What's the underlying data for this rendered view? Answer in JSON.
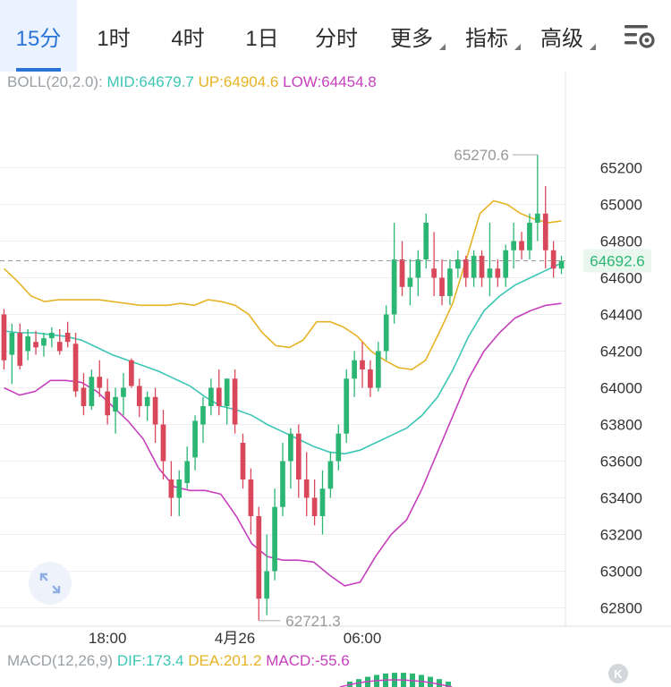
{
  "tabs": [
    {
      "label": "15分",
      "active": true,
      "dropdown": false
    },
    {
      "label": "1时",
      "active": false,
      "dropdown": false
    },
    {
      "label": "4时",
      "active": false,
      "dropdown": false
    },
    {
      "label": "1日",
      "active": false,
      "dropdown": false
    },
    {
      "label": "分时",
      "active": false,
      "dropdown": false
    },
    {
      "label": "更多",
      "active": false,
      "dropdown": true
    },
    {
      "label": "指标",
      "active": false,
      "dropdown": true
    },
    {
      "label": "高级",
      "active": false,
      "dropdown": true
    }
  ],
  "settings_icon": "chart-settings-icon",
  "boll": {
    "name": "BOLL(20,2.0):",
    "mid_label": "MID:64679.7",
    "up_label": "UP:64904.6",
    "low_label": "LOW:64454.8",
    "colors": {
      "mid": "#3cc6b5",
      "up": "#e6b325",
      "low": "#c63fbc"
    }
  },
  "macd": {
    "name": "MACD(12,26,9)",
    "dif_label": "DIF:173.4",
    "dea_label": "DEA:201.2",
    "macd_label": "MACD:-55.6",
    "colors": {
      "dif": "#3cc6b5",
      "dea": "#e6b325",
      "macd": "#c63fbc"
    }
  },
  "expand_icon": "expand-arrows-icon",
  "k_button": "K",
  "chart_data": {
    "type": "candlestick",
    "y_ticks": [
      65200,
      65000,
      64800,
      64600,
      64400,
      64200,
      64000,
      63800,
      63600,
      63400,
      63200,
      63000,
      62800
    ],
    "ylim": [
      62700,
      65500
    ],
    "x_ticks": [
      {
        "label": "18:00",
        "index": 13
      },
      {
        "label": "4月26",
        "index": 29
      },
      {
        "label": "06:00",
        "index": 45
      }
    ],
    "current_price": "64692.6",
    "max_label": "65270.6",
    "min_label": "62721.3",
    "colors": {
      "up": "#2bb673",
      "down": "#d9475a"
    },
    "candles": [
      [
        64400,
        64430,
        64100,
        64150
      ],
      [
        64180,
        64350,
        64020,
        64300
      ],
      [
        64300,
        64350,
        64100,
        64120
      ],
      [
        64200,
        64320,
        64150,
        64280
      ],
      [
        64250,
        64310,
        64180,
        64220
      ],
      [
        64230,
        64300,
        64170,
        64270
      ],
      [
        64270,
        64330,
        64220,
        64300
      ],
      [
        64250,
        64320,
        64180,
        64200
      ],
      [
        64300,
        64360,
        64220,
        64250
      ],
      [
        64240,
        64300,
        63950,
        63980
      ],
      [
        64000,
        64080,
        63850,
        63900
      ],
      [
        63900,
        64100,
        63880,
        64060
      ],
      [
        64060,
        64150,
        63950,
        64000
      ],
      [
        63980,
        64050,
        63800,
        63850
      ],
      [
        63870,
        64000,
        63750,
        63950
      ],
      [
        63950,
        64080,
        63850,
        64000
      ],
      [
        64150,
        64160,
        64000,
        64010
      ],
      [
        64010,
        64050,
        63840,
        63900
      ],
      [
        63900,
        63980,
        63820,
        63950
      ],
      [
        63950,
        64000,
        63700,
        63800
      ],
      [
        63800,
        63880,
        63500,
        63600
      ],
      [
        63500,
        63600,
        63300,
        63400
      ],
      [
        63400,
        63550,
        63300,
        63500
      ],
      [
        63480,
        63680,
        63450,
        63600
      ],
      [
        63620,
        63850,
        63550,
        63820
      ],
      [
        63800,
        63950,
        63700,
        63900
      ],
      [
        63900,
        64050,
        63850,
        64000
      ],
      [
        64000,
        64100,
        63850,
        63900
      ],
      [
        63900,
        64050,
        63800,
        64050
      ],
      [
        64050,
        64100,
        63750,
        63800
      ],
      [
        63700,
        63750,
        63450,
        63500
      ],
      [
        63500,
        63560,
        63200,
        63300
      ],
      [
        63300,
        63350,
        62730,
        62850
      ],
      [
        62850,
        63200,
        62760,
        63000
      ],
      [
        63000,
        63450,
        62950,
        63350
      ],
      [
        63350,
        63700,
        63300,
        63600
      ],
      [
        63600,
        63780,
        63450,
        63750
      ],
      [
        63750,
        63800,
        63400,
        63500
      ],
      [
        63500,
        63650,
        63300,
        63400
      ],
      [
        63400,
        63500,
        63250,
        63300
      ],
      [
        63300,
        63550,
        63200,
        63450
      ],
      [
        63450,
        63650,
        63400,
        63600
      ],
      [
        63600,
        63800,
        63550,
        63750
      ],
      [
        63750,
        64100,
        63700,
        64050
      ],
      [
        64050,
        64200,
        63950,
        64150
      ],
      [
        64150,
        64250,
        64000,
        64100
      ],
      [
        64100,
        64150,
        63950,
        64000
      ],
      [
        64000,
        64250,
        63980,
        64200
      ],
      [
        64200,
        64450,
        64150,
        64400
      ],
      [
        64400,
        64900,
        64350,
        64700
      ],
      [
        64700,
        64800,
        64500,
        64550
      ],
      [
        64550,
        64700,
        64450,
        64600
      ],
      [
        64600,
        64750,
        64500,
        64700
      ],
      [
        64700,
        64950,
        64650,
        64900
      ],
      [
        64650,
        64850,
        64500,
        64600
      ],
      [
        64600,
        64700,
        64450,
        64500
      ],
      [
        64500,
        64700,
        64450,
        64650
      ],
      [
        64650,
        64750,
        64600,
        64700
      ],
      [
        64700,
        64720,
        64550,
        64600
      ],
      [
        64600,
        64750,
        64550,
        64720
      ],
      [
        64720,
        64750,
        64550,
        64600
      ],
      [
        64600,
        64900,
        64500,
        64650
      ],
      [
        64650,
        64700,
        64550,
        64600
      ],
      [
        64600,
        64780,
        64550,
        64750
      ],
      [
        64750,
        64900,
        64650,
        64800
      ],
      [
        64800,
        64850,
        64700,
        64750
      ],
      [
        64750,
        64950,
        64700,
        64900
      ],
      [
        64900,
        65270.6,
        64800,
        64950
      ],
      [
        64950,
        65100,
        64650,
        64750
      ],
      [
        64750,
        64800,
        64600,
        64650
      ],
      [
        64650,
        64720,
        64620,
        64692.6
      ]
    ],
    "boll_up": [
      64650,
      64580,
      64500,
      64470,
      64480,
      64480,
      64480,
      64480,
      64470,
      64460,
      64450,
      64450,
      64450,
      64460,
      64450,
      64480,
      64470,
      64450,
      64400,
      64300,
      64230,
      64220,
      64260,
      64360,
      64360,
      64330,
      64280,
      64200,
      64150,
      64110,
      64100,
      64150,
      64300,
      64460,
      64700,
      64950,
      65020,
      65000,
      64950,
      64920,
      64900,
      64910
    ],
    "boll_mid": [
      64310,
      64300,
      64300,
      64290,
      64280,
      64260,
      64220,
      64180,
      64150,
      64120,
      64090,
      64050,
      64010,
      63950,
      63900,
      63880,
      63850,
      63800,
      63760,
      63720,
      63680,
      63650,
      63640,
      63660,
      63700,
      63740,
      63780,
      63850,
      63950,
      64100,
      64280,
      64420,
      64500,
      64560,
      64600,
      64640,
      64680
    ],
    "boll_low": [
      64000,
      63960,
      63980,
      64040,
      64040,
      64030,
      63980,
      63900,
      63820,
      63720,
      63560,
      63460,
      63440,
      63440,
      63420,
      63300,
      63150,
      63080,
      63060,
      63060,
      63050,
      62980,
      62920,
      62940,
      63080,
      63200,
      63280,
      63450,
      63650,
      63850,
      64050,
      64200,
      64300,
      64380,
      64420,
      64450,
      64460
    ]
  }
}
